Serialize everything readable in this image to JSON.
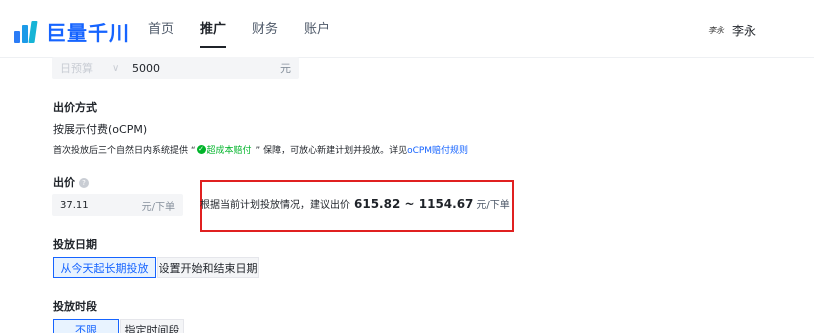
{
  "header": {
    "logo_text": "巨量千川",
    "nav": [
      "首页",
      "推广",
      "财务",
      "账户"
    ],
    "active_nav_index": 1,
    "user_avatar_text": "李永",
    "user_name": "李永"
  },
  "budget": {
    "type": "日预算",
    "value": "5000",
    "unit": "元"
  },
  "bid_method": {
    "title": "出价方式",
    "mode": "按展示付费(oCPM)",
    "notice_prefix": "首次投放后三个自然日内系统提供 “",
    "notice_badge": "超成本赔付",
    "notice_suffix": "” 保障，可放心新建计划并投放。详见",
    "notice_link": "oCPM赔付规则"
  },
  "bid": {
    "title": "出价",
    "value": "37.11",
    "unit": "元/下单",
    "suggest_prefix": "根据当前计划投放情况，建议出价",
    "suggest_low": "615.82",
    "suggest_sep": "~",
    "suggest_high": "1154.67",
    "suggest_unit": "元/下单"
  },
  "schedule": {
    "title": "投放日期",
    "options": [
      "从今天起长期投放",
      "设置开始和结束日期"
    ],
    "selected": 0
  },
  "time_slot": {
    "title": "投放时段",
    "options": [
      "不限",
      "指定时间段"
    ],
    "selected": 0
  },
  "colors": {
    "brand": "#1664ff",
    "highlight_frame": "#e02020",
    "guarantee_green": "#00b42a"
  }
}
